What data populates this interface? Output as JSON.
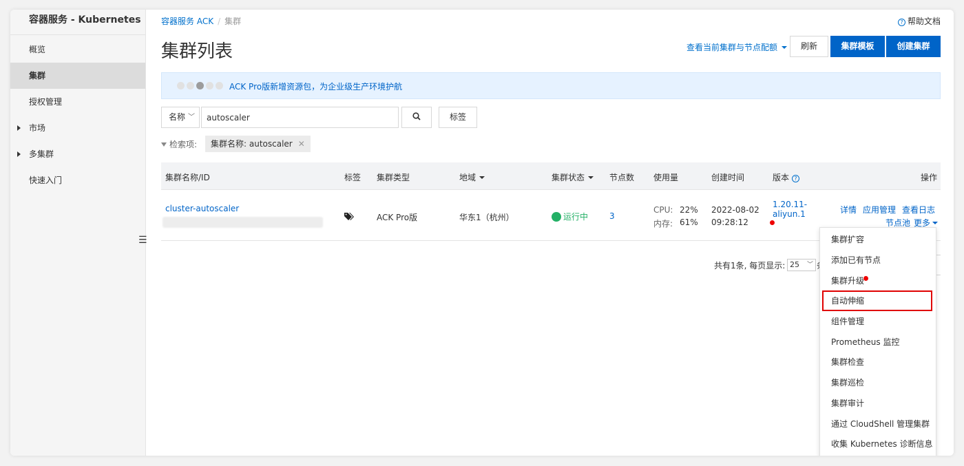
{
  "sidebar": {
    "title": "容器服务 - Kubernetes",
    "items": [
      {
        "label": "概览"
      },
      {
        "label": "集群"
      },
      {
        "label": "授权管理"
      },
      {
        "label": "市场"
      },
      {
        "label": "多集群"
      },
      {
        "label": "快速入门"
      }
    ]
  },
  "breadcrumb": {
    "root": "容器服务 ACK",
    "sep": "/",
    "current": "集群"
  },
  "help": {
    "label": "帮助文档"
  },
  "page_title": "集群列表",
  "toolbar": {
    "quota_link": "查看当前集群与节点配额",
    "refresh": "刷新",
    "template": "集群模板",
    "create": "创建集群"
  },
  "banner": {
    "text": "ACK Pro版新增资源包，为企业级生产环境护航"
  },
  "search": {
    "field": "名称",
    "value": "autoscaler",
    "tag_button": "标签"
  },
  "filter": {
    "label": "检索项:",
    "tag": "集群名称: autoscaler"
  },
  "table": {
    "headers": [
      "集群名称/ID",
      "标签",
      "集群类型",
      "地域",
      "集群状态",
      "节点数",
      "使用量",
      "创建时间",
      "版本",
      "操作"
    ],
    "row": {
      "name": "cluster-autoscaler",
      "type": "ACK Pro版",
      "region": "华东1（杭州）",
      "status": "运行中",
      "nodes": "3",
      "cpu_label": "CPU:",
      "cpu_value": "22%",
      "mem_label": "内存:",
      "mem_value": "61%",
      "created_date": "2022-08-02",
      "created_time": "09:28:12",
      "version_line1": "1.20.11-",
      "version_line2": "aliyun.1",
      "actions": {
        "details": "详情",
        "apps": "应用管理",
        "logs": "查看日志",
        "nodepool": "节点池",
        "more": "更多"
      }
    }
  },
  "pagination": {
    "text": "共有1条, 每页显示:",
    "page_size": "25",
    "suffix": "条"
  },
  "more_menu": [
    "集群扩容",
    "添加已有节点",
    "集群升级",
    "自动伸缩",
    "组件管理",
    "Prometheus 监控",
    "集群检查",
    "集群巡检",
    "集群审计",
    "通过 CloudShell 管理集群",
    "收集 Kubernetes 诊断信息"
  ],
  "colors": {
    "primary": "#0064c8",
    "status_ok": "#23b066",
    "highlight": "#e00000"
  }
}
